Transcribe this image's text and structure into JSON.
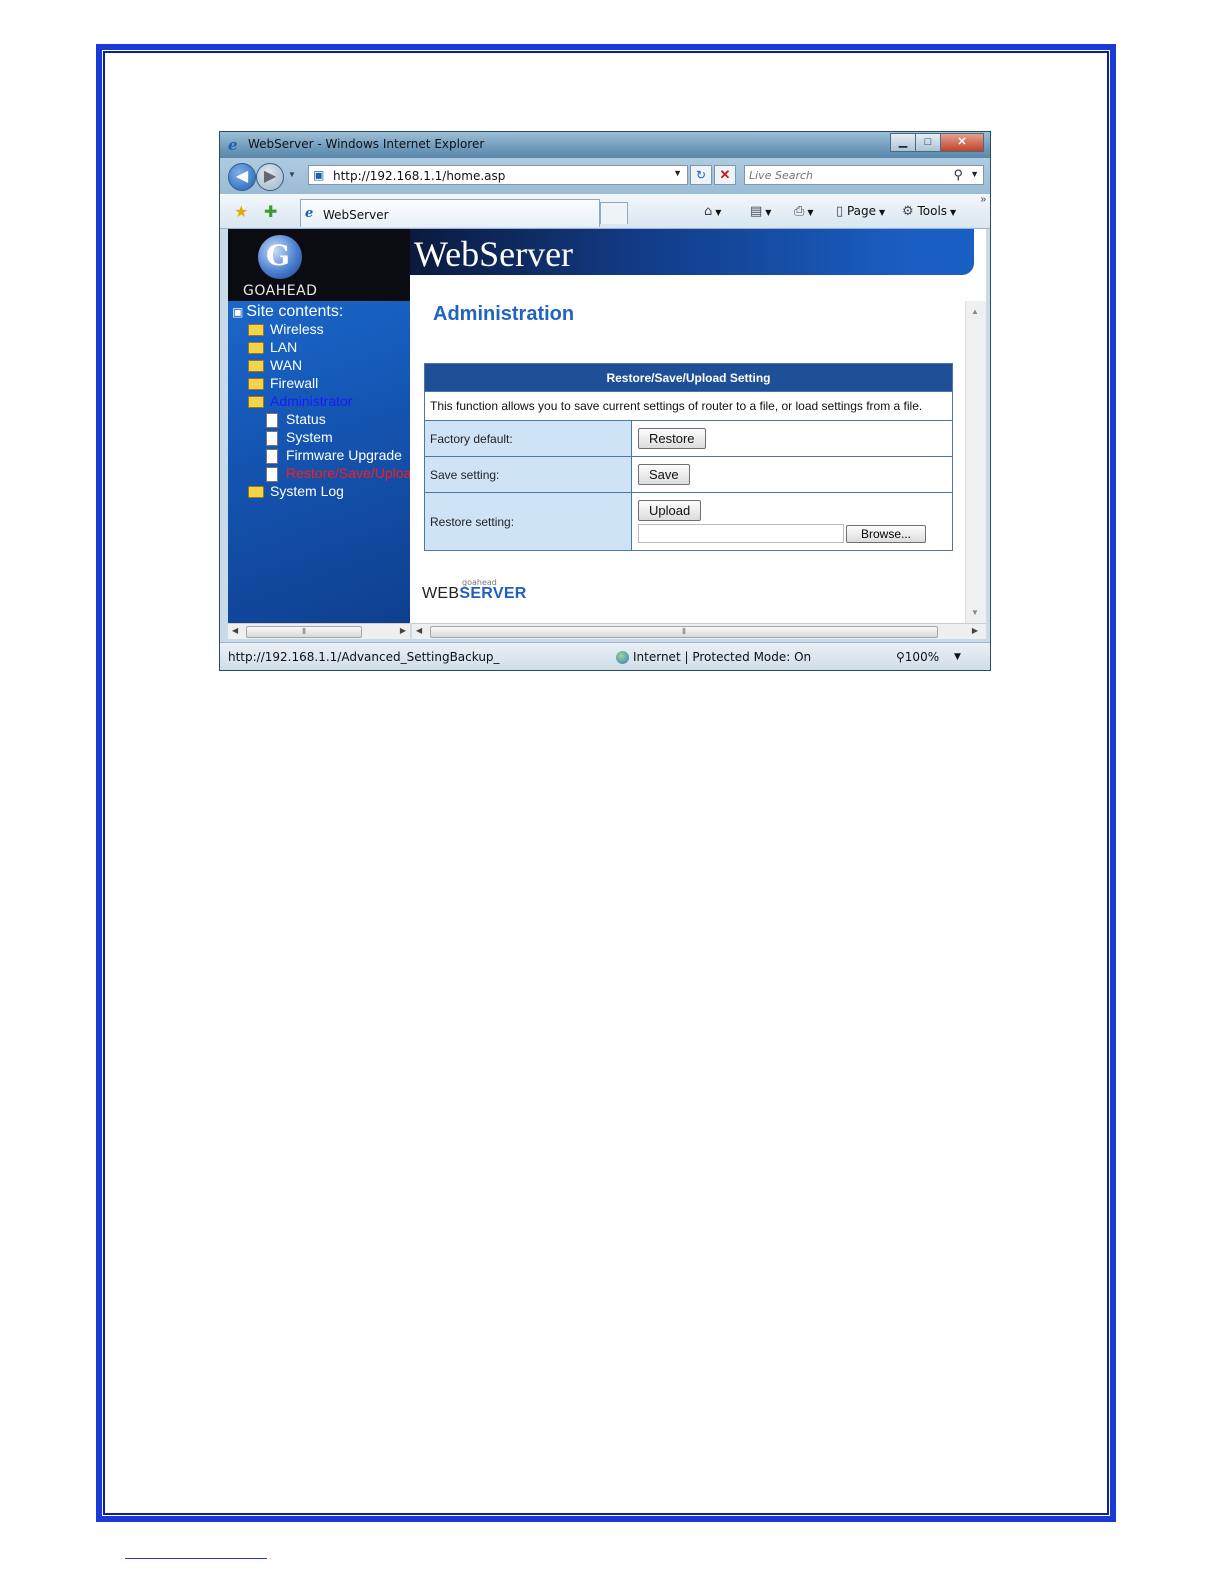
{
  "browser": {
    "title": "WebServer - Windows Internet Explorer",
    "url": "http://192.168.1.1/home.asp",
    "search_placeholder": "Live Search",
    "tab_label": "WebServer",
    "cmd_page": "Page",
    "cmd_tools": "Tools",
    "status_url": "http://192.168.1.1/Advanced_SettingBackup_",
    "status_zone": "Internet | Protected Mode: On",
    "zoom": "100%"
  },
  "site": {
    "logo_text": "GOAHEAD",
    "banner_title": "WebServer",
    "tree_head": "Site contents:",
    "tree": {
      "wireless": "Wireless",
      "lan": "LAN",
      "wan": "WAN",
      "firewall": "Firewall",
      "administrator": "Administrator",
      "status": "Status",
      "system": "System",
      "firmware": "Firmware Upgrade",
      "restore": "Restore/Save/Upload",
      "syslog": "System Log"
    }
  },
  "main": {
    "page_title": "Administration",
    "table_header": "Restore/Save/Upload Setting",
    "description": "This function allows you to save current settings of router to a file, or load settings from a file.",
    "rows": [
      {
        "label": "Factory default:",
        "button": "Restore"
      },
      {
        "label": "Save setting:",
        "button": "Save"
      },
      {
        "label": "Restore setting:",
        "button": "Upload",
        "browse": "Browse..."
      }
    ],
    "footer_small": "goahead",
    "footer_web": "WEB",
    "footer_server": "SERVER"
  }
}
